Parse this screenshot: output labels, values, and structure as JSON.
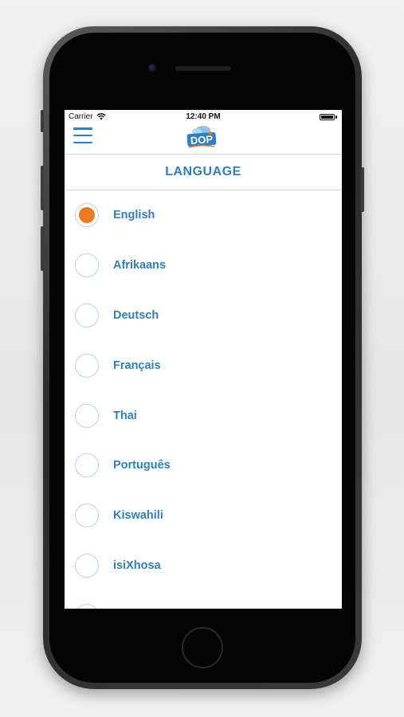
{
  "status_bar": {
    "carrier": "Carrier",
    "time": "12:40 PM"
  },
  "header": {
    "logo_text": "DOP",
    "title": "LANGUAGE"
  },
  "colors": {
    "accent": "#2e7fbf",
    "selected": "#ec7b1f",
    "radio_border": "#b8d2e8"
  },
  "languages": [
    {
      "label": "English",
      "selected": true
    },
    {
      "label": "Afrikaans",
      "selected": false
    },
    {
      "label": "Deutsch",
      "selected": false
    },
    {
      "label": "Français",
      "selected": false
    },
    {
      "label": "Thai",
      "selected": false
    },
    {
      "label": "Português",
      "selected": false
    },
    {
      "label": "Kiswahili",
      "selected": false
    },
    {
      "label": "isiXhosa",
      "selected": false
    }
  ]
}
